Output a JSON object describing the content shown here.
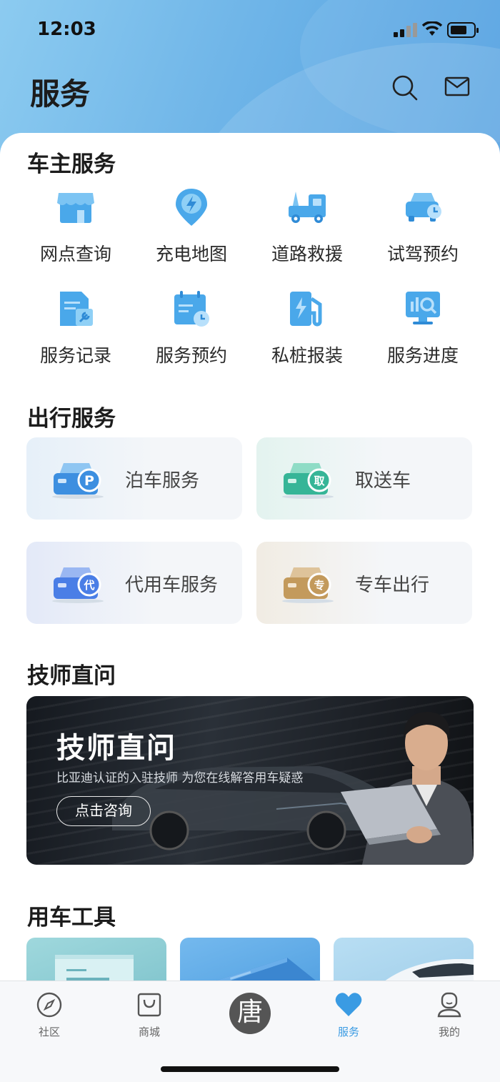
{
  "status_bar": {
    "time": "12:03"
  },
  "header": {
    "title": "服务"
  },
  "owner_services": {
    "title": "车主服务",
    "items": [
      {
        "label": "网点查询",
        "icon": "store-icon"
      },
      {
        "label": "充电地图",
        "icon": "charge-pin-icon"
      },
      {
        "label": "道路救援",
        "icon": "tow-truck-icon"
      },
      {
        "label": "试驾预约",
        "icon": "car-clock-icon"
      },
      {
        "label": "服务记录",
        "icon": "service-record-icon"
      },
      {
        "label": "服务预约",
        "icon": "calendar-clock-icon"
      },
      {
        "label": "私桩报装",
        "icon": "charger-pile-icon"
      },
      {
        "label": "服务进度",
        "icon": "progress-monitor-icon"
      }
    ]
  },
  "travel_services": {
    "title": "出行服务",
    "cards": [
      {
        "label": "泊车服务",
        "badge": "P",
        "color": "#3d8fe0"
      },
      {
        "label": "取送车",
        "badge": "取",
        "color": "#36b597"
      },
      {
        "label": "代用车服务",
        "badge": "代",
        "color": "#4a7ee6"
      },
      {
        "label": "专车出行",
        "badge": "专",
        "color": "#c39a5c"
      }
    ]
  },
  "technician": {
    "title": "技师直问",
    "banner_title": "技师直问",
    "banner_subtitle": "比亚迪认证的入驻技师  为您在线解答用车疑惑",
    "button": "点击咨询"
  },
  "tools": {
    "title": "用车工具"
  },
  "tabbar": {
    "items": [
      {
        "label": "社区"
      },
      {
        "label": "商城"
      },
      {
        "label": "唐"
      },
      {
        "label": "服务"
      },
      {
        "label": "我的"
      }
    ]
  },
  "colors": {
    "accent": "#3a9be3",
    "icon_blue": "#4aa8ea"
  }
}
